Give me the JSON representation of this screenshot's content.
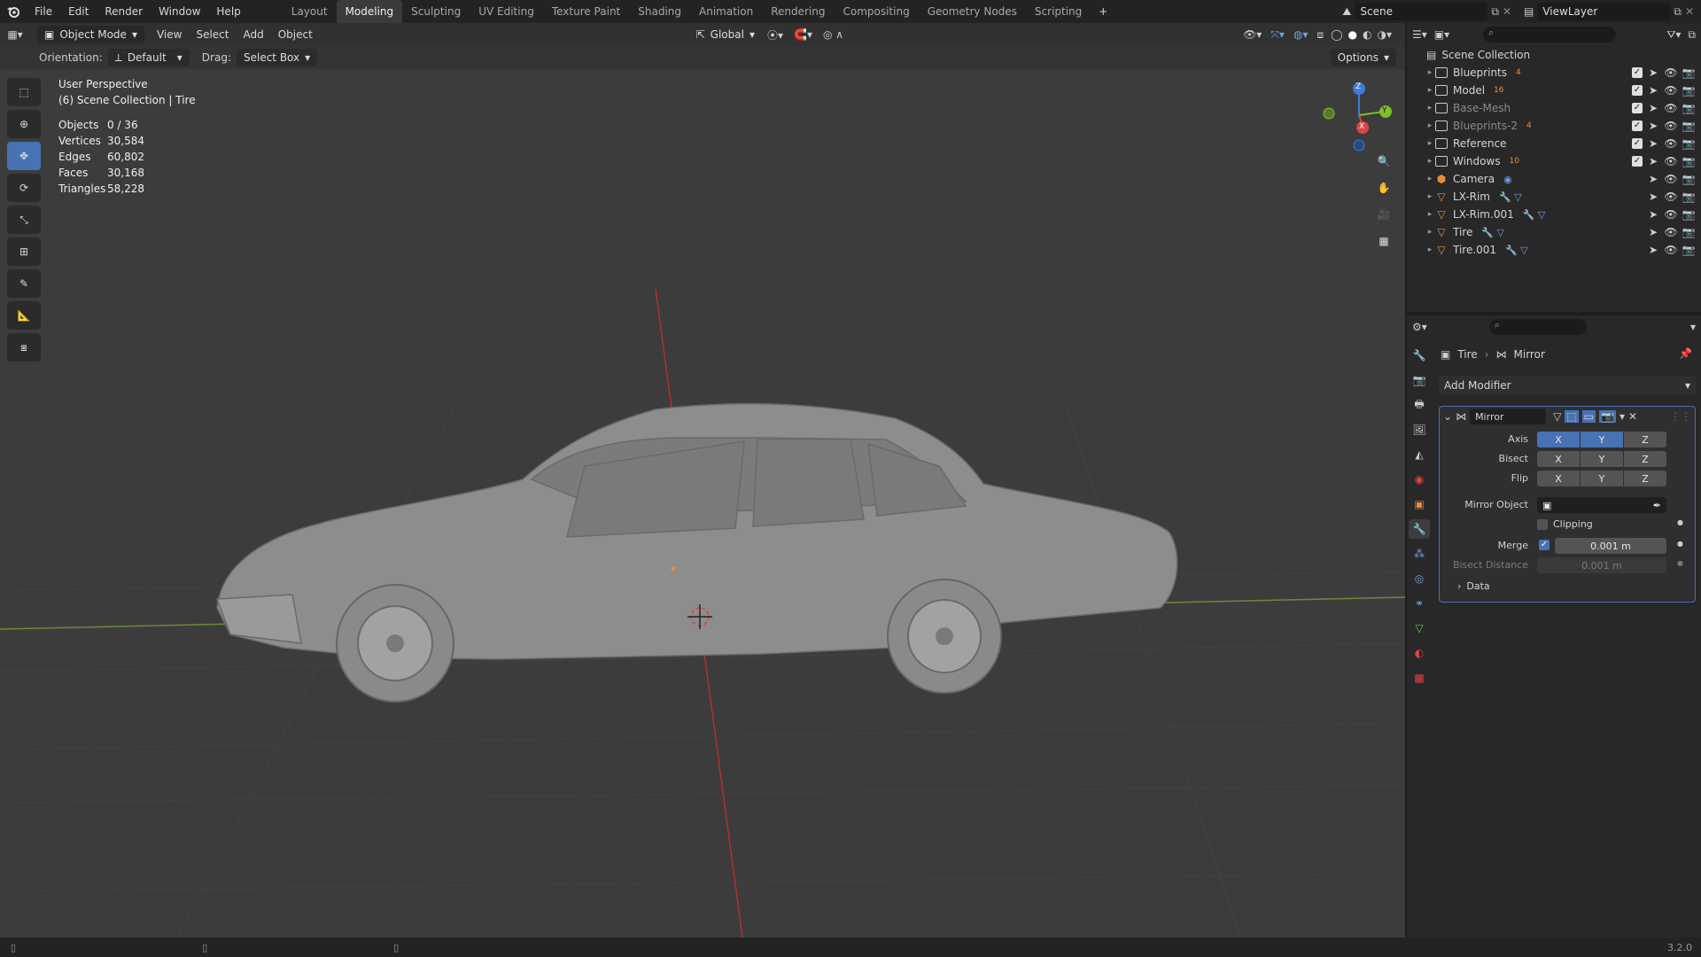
{
  "topbar": {
    "menus": [
      "File",
      "Edit",
      "Render",
      "Window",
      "Help"
    ],
    "workspaces": [
      "Layout",
      "Modeling",
      "Sculpting",
      "UV Editing",
      "Texture Paint",
      "Shading",
      "Animation",
      "Rendering",
      "Compositing",
      "Geometry Nodes",
      "Scripting"
    ],
    "active_workspace": "Modeling",
    "add_tab": "+",
    "scene": "Scene",
    "view_layer": "ViewLayer"
  },
  "viewport_header": {
    "mode": "Object Mode",
    "menus": [
      "View",
      "Select",
      "Add",
      "Object"
    ],
    "transform_orientation": "Global",
    "orientation_label": "Orientation:",
    "orientation_value": "Default",
    "drag_label": "Drag:",
    "drag_value": "Select Box",
    "options": "Options"
  },
  "viewport": {
    "view_name": "User Perspective",
    "collection_path": "(6) Scene Collection | Tire",
    "stats": [
      {
        "label": "Objects",
        "value": "0 / 36"
      },
      {
        "label": "Vertices",
        "value": "30,584"
      },
      {
        "label": "Edges",
        "value": "60,802"
      },
      {
        "label": "Faces",
        "value": "30,168"
      },
      {
        "label": "Triangles",
        "value": "58,228"
      }
    ],
    "gizmo": {
      "x": "X",
      "y": "Y",
      "z": "Z"
    }
  },
  "outliner": {
    "root": "Scene Collection",
    "items": [
      {
        "name": "Blueprints",
        "kind": "collection",
        "badge": "4",
        "dim": false,
        "checked": true
      },
      {
        "name": "Model",
        "kind": "collection",
        "badge": "16",
        "dim": false,
        "checked": true
      },
      {
        "name": "Base-Mesh",
        "kind": "collection",
        "badge": "",
        "dim": true,
        "checked": true
      },
      {
        "name": "Blueprints-2",
        "kind": "collection",
        "badge": "4",
        "dim": true,
        "checked": true
      },
      {
        "name": "Reference",
        "kind": "collection",
        "badge": "",
        "dim": false,
        "checked": true
      },
      {
        "name": "Windows",
        "kind": "collection",
        "badge": "10",
        "dim": false,
        "checked": true
      },
      {
        "name": "Camera",
        "kind": "object",
        "badge": "",
        "dim": false,
        "checked": false
      },
      {
        "name": "LX-Rim",
        "kind": "object",
        "badge": "",
        "dim": false,
        "checked": false
      },
      {
        "name": "LX-Rim.001",
        "kind": "object",
        "badge": "",
        "dim": false,
        "checked": false
      },
      {
        "name": "Tire",
        "kind": "object",
        "badge": "",
        "dim": false,
        "checked": false
      },
      {
        "name": "Tire.001",
        "kind": "object",
        "badge": "",
        "dim": false,
        "checked": false
      }
    ]
  },
  "properties": {
    "breadcrumb_object": "Tire",
    "breadcrumb_modifier": "Mirror",
    "add_modifier": "Add Modifier",
    "modifier_name": "Mirror",
    "axis_label": "Axis",
    "bisect_label": "Bisect",
    "flip_label": "Flip",
    "axes": [
      "X",
      "Y",
      "Z"
    ],
    "axis_active": [
      true,
      true,
      false
    ],
    "mirror_object_label": "Mirror Object",
    "clipping_label": "Clipping",
    "merge_label": "Merge",
    "merge_value": "0.001 m",
    "bisect_distance_label": "Bisect Distance",
    "bisect_distance_value": "0.001 m",
    "data_label": "Data"
  },
  "statusbar": {
    "version": "3.2.0"
  },
  "colors": {
    "accent": "#4772b3",
    "object_orange": "#e98c3c",
    "mesh_green": "#6fc26f",
    "viewport_bg": "#3c3c3c"
  }
}
